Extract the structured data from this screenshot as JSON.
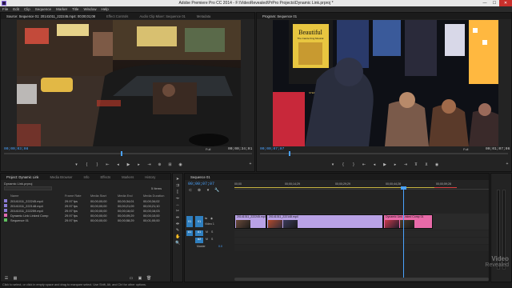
{
  "window": {
    "title": "Adobe Premiere Pro CC 2014 - F:\\VideoRevealed\\PrPro Projects\\Dynamic Link.prproj *",
    "min": "—",
    "max": "☐",
    "close": "✕"
  },
  "menu": [
    "File",
    "Edit",
    "Clip",
    "Sequence",
    "Marker",
    "Title",
    "Window",
    "Help"
  ],
  "source_monitor": {
    "tabs": [
      "Source: Sequence 01: 20141011_222245.mp4: 00;00;01;08",
      "Effect Controls",
      "Audio Clip Mixer: Sequence 01",
      "Metadata"
    ],
    "timecode_left": "00;00;03;08",
    "fit": "Full",
    "timecode_right": "00;00;34;01"
  },
  "program_monitor": {
    "tabs": [
      "Program: Sequence 01"
    ],
    "timecode_left": "00;00;07;07",
    "fit": "Full",
    "timecode_right": "00;01;07;06",
    "scene_signs": {
      "beautiful_title": "Beautiful",
      "beautiful_subtitle": "The Carole King Musical",
      "theater": "STEPHEN SONDHEIM"
    }
  },
  "project_panel": {
    "tabs": [
      "Project: Dynamic Link",
      "Media Browser",
      "Info",
      "Effects",
      "Markers",
      "History"
    ],
    "file": "Dynamic Link.prproj",
    "item_count": "5 Items",
    "columns": [
      "Name",
      "Frame Rate",
      "Media Start",
      "Media End",
      "Media Duration"
    ],
    "rows": [
      {
        "name": "20141011_222245.mp4",
        "rate": "29.97 fps",
        "start": "00;00;00;00",
        "end": "00;00;34;01",
        "dur": "00;00;34;02",
        "color": "#8a7bd6"
      },
      {
        "name": "20141011_222148.mp4",
        "rate": "29.97 fps",
        "start": "00;00;00;00",
        "end": "00;00;21;09",
        "dur": "00;00;21;10",
        "color": "#8a7bd6"
      },
      {
        "name": "20141011_222259.mp4",
        "rate": "29.97 fps",
        "start": "00;00;00;00",
        "end": "00;00;16;02",
        "dur": "00;00;16;03",
        "color": "#8a7bd6"
      },
      {
        "name": "Dynamic Link Linked Comp",
        "rate": "29.97 fps",
        "start": "00;00;00;00",
        "end": "00;00;09;29",
        "dur": "00;00;10;00",
        "color": "#e06ab0"
      },
      {
        "name": "Sequence 01",
        "rate": "29.97 fps",
        "start": "00;00;00;00",
        "end": "00;00;58;29",
        "dur": "00;01;00;00",
        "color": "#5fbf5f"
      }
    ]
  },
  "timeline": {
    "tab": "Sequence 01",
    "timecode": "00;00;07;07",
    "ruler": [
      "00;00",
      "00;00;14;29",
      "00;00;29;29",
      "00;00;44;28",
      "00;00;59;28"
    ],
    "tracks": [
      {
        "target": "V1",
        "name": "V1",
        "label": "Video 1"
      },
      {
        "target": "A1",
        "name": "A1"
      },
      {
        "target": "",
        "name": "A2"
      },
      {
        "target": "",
        "name": "Master",
        "value": "0.0"
      }
    ],
    "clips": [
      {
        "label": "20141011_222245.mp4",
        "color": "#b9a2e6"
      },
      {
        "label": "20141011_222148.mp4",
        "color": "#b9a2e6"
      },
      {
        "label": "Dynamic Link Linked Comp 01",
        "color": "#e86aa8"
      }
    ]
  },
  "status_bar": "Click to select, or click in empty space and drag to marquee select. Use Shift, Alt, and Ctrl for other options.",
  "watermark": [
    "Video",
    "Revealed"
  ]
}
